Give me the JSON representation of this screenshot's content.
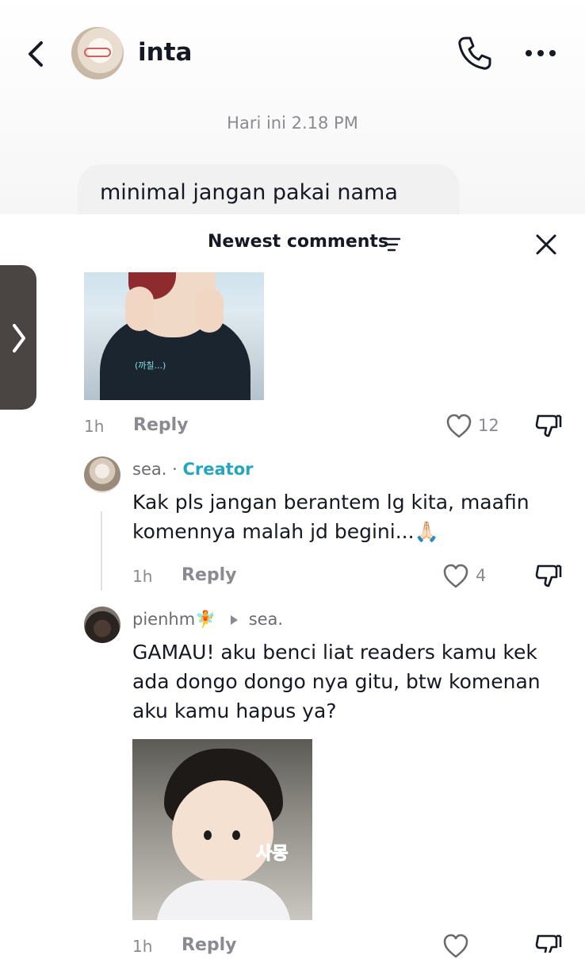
{
  "header": {
    "contact_name": "inta",
    "timestamp": "Hari ini 2.18 PM",
    "message": "minimal jangan pakai nama"
  },
  "sheet": {
    "title": "Newest comments"
  },
  "comments": [
    {
      "time": "1h",
      "reply_label": "Reply",
      "likes": "12",
      "image": "sticker-crying-man"
    },
    {
      "username": "sea.",
      "separator": "·",
      "badge": "Creator",
      "text_line1": "Kak pls jangan berantem lg kita, maafin",
      "text_line2": "komennya malah jd begini...🙏🏻",
      "time": "1h",
      "reply_label": "Reply",
      "likes": "4"
    },
    {
      "username": "pienhm🧚",
      "reply_to": "sea.",
      "text_line1": "GAMAU! aku benci liat readers kamu kek",
      "text_line2": "ada dongo dongo nya gitu, btw komenan",
      "text_line3": "aku kamu hapus ya?",
      "sticker_text": "사몽",
      "time": "1h",
      "reply_label": "Reply"
    }
  ],
  "sticker1_caption": "(까칠...)",
  "icons": [
    "back-icon",
    "phone-icon",
    "more-icon",
    "filter-icon",
    "close-icon",
    "chevron-right-icon",
    "heart-icon",
    "dislike-icon"
  ],
  "colors": {
    "creator": "#25a6c0",
    "muted": "#8a8b91",
    "text": "#161823"
  }
}
